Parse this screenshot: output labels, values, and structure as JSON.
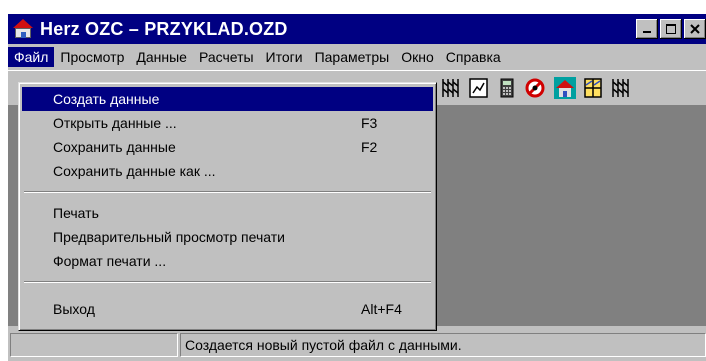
{
  "window": {
    "title": "Herz OZC – PRZYKLAD.OZD"
  },
  "title_buttons": {
    "minimize": "_",
    "maximize": "□",
    "close": "×"
  },
  "menu": [
    {
      "label": "Файл",
      "active": true
    },
    {
      "label": "Просмотр"
    },
    {
      "label": "Данные"
    },
    {
      "label": "Расчеты"
    },
    {
      "label": "Итоги"
    },
    {
      "label": "Параметры"
    },
    {
      "label": "Окно"
    },
    {
      "label": "Справка"
    }
  ],
  "file_menu": {
    "items": [
      {
        "label": "Создать данные",
        "shortcut": "",
        "highlighted": true
      },
      {
        "label": "Открыть данные ...",
        "shortcut": "F3"
      },
      {
        "label": "Сохранить данные",
        "shortcut": "F2"
      },
      {
        "label": "Сохранить данные как ...",
        "shortcut": ""
      },
      {
        "label": "Печать",
        "shortcut": ""
      },
      {
        "label": "Предварительный просмотр печати",
        "shortcut": ""
      },
      {
        "label": "Формат печати ...",
        "shortcut": ""
      },
      {
        "label": "Выход",
        "shortcut": "Alt+F4"
      }
    ]
  },
  "toolbar": {
    "icons": [
      "radiator-icon",
      "document-chart-icon",
      "calculator-icon",
      "stop-icon",
      "house-icon",
      "window-icon",
      "radiator-icon"
    ]
  },
  "statusbar": {
    "message": "Создается новый пустой файл с данными."
  },
  "colors": {
    "titlebar": "#000082",
    "face": "#c0c0c0",
    "client": "#808080",
    "highlight": "#000082"
  }
}
